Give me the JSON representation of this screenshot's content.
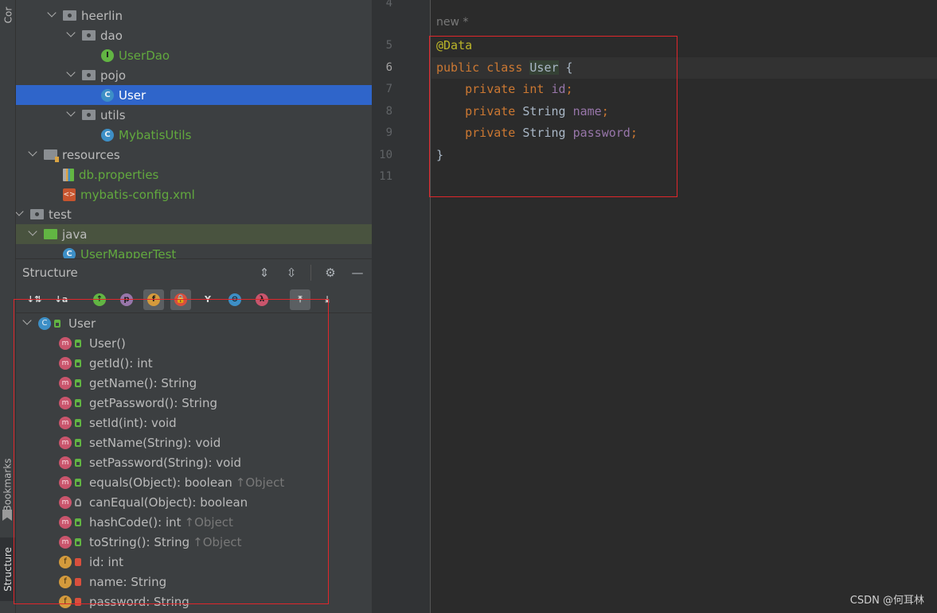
{
  "sidebar_tabs": {
    "commit": "Cor",
    "bookmarks": "Bookmarks",
    "structure": "Structure"
  },
  "project_tree": [
    {
      "label": "heerlin",
      "kind": "package",
      "indent": 4,
      "expanded": true
    },
    {
      "label": "dao",
      "kind": "package",
      "indent": 5,
      "expanded": true
    },
    {
      "label": "UserDao",
      "kind": "interface",
      "indent": 6
    },
    {
      "label": "pojo",
      "kind": "package",
      "indent": 5,
      "expanded": true
    },
    {
      "label": "User",
      "kind": "class",
      "indent": 6,
      "selected": true
    },
    {
      "label": "utils",
      "kind": "package",
      "indent": 5,
      "expanded": true
    },
    {
      "label": "MybatisUtils",
      "kind": "class",
      "indent": 6
    },
    {
      "label": "resources",
      "kind": "resources",
      "indent": 3,
      "expanded": true
    },
    {
      "label": "db.properties",
      "kind": "properties",
      "indent": 4
    },
    {
      "label": "mybatis-config.xml",
      "kind": "xml",
      "indent": 4
    },
    {
      "label": "test",
      "kind": "folder",
      "indent": 2,
      "expanded": true
    },
    {
      "label": "java",
      "kind": "testroot",
      "indent": 3,
      "expanded": true
    },
    {
      "label": "UserMapperTest",
      "kind": "class",
      "indent": 4
    }
  ],
  "structure": {
    "title": "Structure",
    "header_actions": [
      "expand-all-icon",
      "collapse-all-icon",
      "gear-icon",
      "hide-icon"
    ],
    "toolbar": [
      {
        "icon": "sort-visibility-icon",
        "glyph": "↓⇅"
      },
      {
        "icon": "sort-alpha-icon",
        "glyph": "↓a"
      },
      {
        "icon": "show-inherited-icon",
        "glyph": "↑",
        "color": "#62b543"
      },
      {
        "icon": "show-properties-icon",
        "glyph": "p",
        "color": "#9876aa"
      },
      {
        "icon": "show-fields-icon",
        "glyph": "f",
        "color": "#d49a3c",
        "active": true
      },
      {
        "icon": "show-non-public-icon",
        "glyph": "🔒",
        "color": "#d94f3d",
        "active": true
      },
      {
        "icon": "show-includes-icon",
        "glyph": "Y"
      },
      {
        "icon": "show-anonymous-icon",
        "glyph": "⊖",
        "color": "#3d8fc6"
      },
      {
        "icon": "show-lambdas-icon",
        "glyph": "λ",
        "color": "#c9556c"
      },
      {
        "icon": "autoscroll-to-source-icon",
        "glyph": "⤒",
        "active": true
      },
      {
        "icon": "autoscroll-from-source-icon",
        "glyph": "⤓"
      }
    ],
    "root": "User",
    "members": [
      {
        "kind": "method",
        "vis": "public",
        "text": "User()"
      },
      {
        "kind": "method",
        "vis": "public",
        "text": "getId(): int"
      },
      {
        "kind": "method",
        "vis": "public",
        "text": "getName(): String"
      },
      {
        "kind": "method",
        "vis": "public",
        "text": "getPassword(): String"
      },
      {
        "kind": "method",
        "vis": "public",
        "text": "setId(int): void"
      },
      {
        "kind": "method",
        "vis": "public",
        "text": "setName(String): void"
      },
      {
        "kind": "method",
        "vis": "public",
        "text": "setPassword(String): void"
      },
      {
        "kind": "method",
        "vis": "public",
        "text": "equals(Object): boolean",
        "inherited": "↑Object"
      },
      {
        "kind": "method",
        "vis": "package",
        "text": "canEqual(Object): boolean"
      },
      {
        "kind": "method",
        "vis": "public",
        "text": "hashCode(): int",
        "inherited": "↑Object"
      },
      {
        "kind": "method",
        "vis": "public",
        "text": "toString(): String",
        "inherited": "↑Object"
      },
      {
        "kind": "field",
        "vis": "private",
        "text": "id: int"
      },
      {
        "kind": "field",
        "vis": "private",
        "text": "name: String"
      },
      {
        "kind": "field",
        "vis": "private",
        "text": "password: String"
      }
    ]
  },
  "editor": {
    "inlay_hint": "new *",
    "first_line_number": "4",
    "line_numbers": [
      "5",
      "6",
      "7",
      "8",
      "9",
      "10",
      "11"
    ],
    "current_line": "6",
    "code": [
      {
        "tokens": [
          {
            "t": "@Data",
            "c": "ann"
          }
        ]
      },
      {
        "tokens": [
          {
            "t": "public class ",
            "c": "kw"
          },
          {
            "t": "User",
            "c": "cls-hl"
          },
          {
            "t": " {",
            "c": ""
          }
        ]
      },
      {
        "tokens": [
          {
            "t": "    private ",
            "c": "kw"
          },
          {
            "t": "int ",
            "c": "kw"
          },
          {
            "t": "id",
            "c": "fld"
          },
          {
            "t": ";",
            "c": "kw"
          }
        ]
      },
      {
        "tokens": [
          {
            "t": "    private ",
            "c": "kw"
          },
          {
            "t": "String ",
            "c": ""
          },
          {
            "t": "name",
            "c": "fld"
          },
          {
            "t": ";",
            "c": "kw"
          }
        ]
      },
      {
        "tokens": [
          {
            "t": "    private ",
            "c": "kw"
          },
          {
            "t": "String ",
            "c": ""
          },
          {
            "t": "password",
            "c": "fld"
          },
          {
            "t": ";",
            "c": "kw"
          }
        ]
      },
      {
        "tokens": [
          {
            "t": "}",
            "c": ""
          }
        ]
      },
      {
        "tokens": []
      }
    ]
  },
  "watermark": "CSDN @何耳林",
  "colors": {
    "selection": "#2f65ca",
    "highlight_box": "#e0262b",
    "keyword": "#cc7832",
    "annotation": "#bbb529",
    "field": "#9876aa"
  }
}
